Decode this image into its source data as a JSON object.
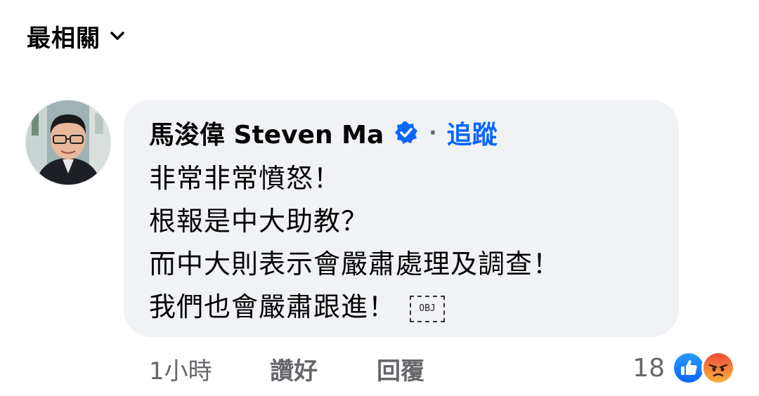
{
  "sort": {
    "label": "最相關"
  },
  "comment": {
    "author": "馬浚偉 Steven Ma",
    "separator": "·",
    "follow_label": "追蹤",
    "lines": [
      "非常非常憤怒！",
      "根報是中大助教？",
      "而中大則表示會嚴肅處理及調查！",
      "我們也會嚴肅跟進！"
    ],
    "obj_tag": "OBJ"
  },
  "meta": {
    "time": "1小時",
    "like_label": "讚好",
    "reply_label": "回覆"
  },
  "reactions": {
    "count": "18",
    "types": [
      "like-icon",
      "angry-icon"
    ]
  },
  "colors": {
    "accent": "#0866ff",
    "bubble_bg": "#f0f2f5",
    "muted_text": "#65676b",
    "angry": "#f0643c"
  }
}
